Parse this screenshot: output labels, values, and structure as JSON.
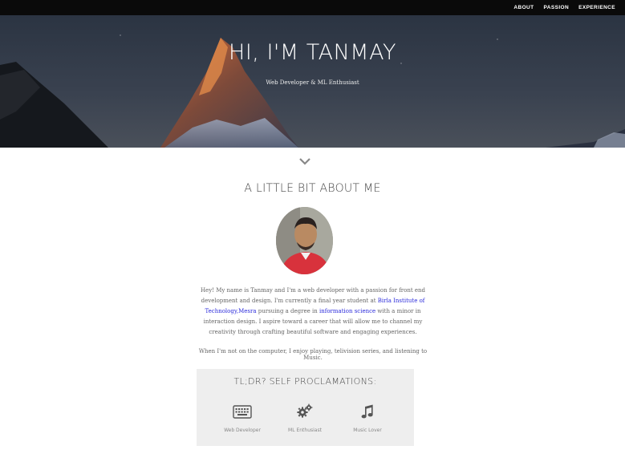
{
  "nav": {
    "items": [
      {
        "label": "ABOUT"
      },
      {
        "label": "PASSION"
      },
      {
        "label": "EXPERIENCE"
      }
    ]
  },
  "hero": {
    "title": "HI, I'M TANMAY",
    "subtitle": "Web Developer & ML Enthusiast"
  },
  "about": {
    "heading": "A LITTLE BIT ABOUT ME",
    "bio_1": "Hey! My name is Tanmay and I'm a web developer with a passion for front end development and design. I'm currently a final year student at ",
    "bio_link_1": "Birla Institute of Technology,Mesra",
    "bio_2": " pursuing a degree in ",
    "bio_link_2": "information science",
    "bio_3": " with a minor in interaction design. I aspire toward a career that will allow me to channel my creativity through crafting beautiful software and engaging experiences.",
    "hobbies": "When I'm not on the computer, I enjoy playing, telivision series, and listening to Music."
  },
  "proclamations": {
    "title": "TL;DR?  SELF PROCLAMATIONS:",
    "items": [
      {
        "label": "Web Developer",
        "icon": "keyboard-icon"
      },
      {
        "label": "ML Enthusiast",
        "icon": "gears-icon"
      },
      {
        "label": "Music Lover",
        "icon": "music-note-icon"
      }
    ]
  },
  "colors": {
    "nav_bg": "#0a0a0a",
    "link": "#2a2adb",
    "panel_bg": "#eeeeee"
  }
}
